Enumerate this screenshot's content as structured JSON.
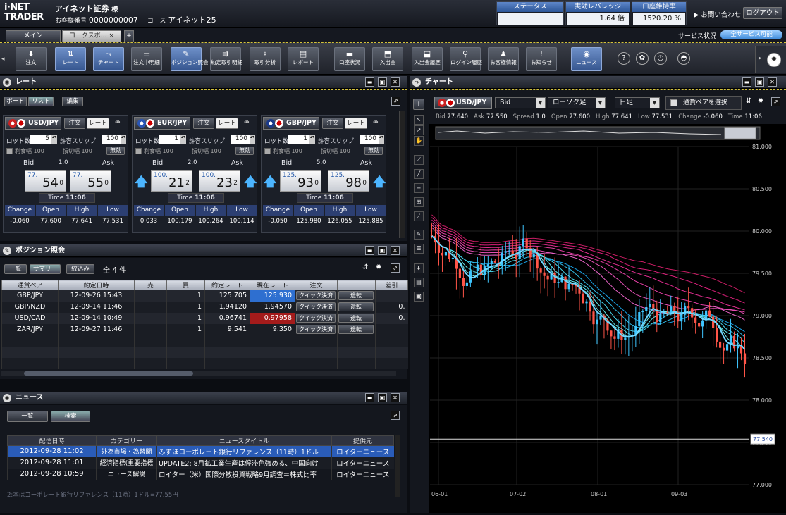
{
  "header": {
    "logo_line1": "i·NET",
    "logo_line2": "TRADER",
    "company": "アイネット証券",
    "honorific": "様",
    "account_label": "お客様番号",
    "account_no": "0000000007",
    "course_label": "コース",
    "course": "アイネット25",
    "status_label": "ステータス",
    "status_value": "",
    "leverage_label": "実効レバレッジ",
    "leverage_value": "1.64 倍",
    "margin_label": "口座維持率",
    "margin_value": "1520.20 %",
    "contact": "▶ お問い合わせ",
    "logout": "ログアウト"
  },
  "tabbar": {
    "tab_main": "メイン",
    "tab_rakuspo": "ロークスボ…",
    "tab_close": "×",
    "tab_add": "+",
    "service_status": "サービス状況",
    "all_service": "全サービス可能"
  },
  "toolbar": [
    {
      "icon": "down-arrow-icon",
      "glyph": "⬇",
      "label": "注文",
      "active": false
    },
    {
      "icon": "rate-icon",
      "glyph": "⇅",
      "label": "レート",
      "active": true
    },
    {
      "icon": "chart-icon",
      "glyph": "⤳",
      "label": "チャート",
      "active": true
    },
    {
      "icon": "order-list-icon",
      "glyph": "☰",
      "label": "注文中明細",
      "active": false
    },
    {
      "icon": "position-icon",
      "glyph": "✎",
      "label": "ポジション照会",
      "active": true
    },
    {
      "icon": "history-icon",
      "glyph": "⇉",
      "label": "約定取引明細",
      "active": false
    },
    {
      "icon": "analysis-icon",
      "glyph": "⌖",
      "label": "取引分析",
      "active": false
    },
    {
      "icon": "report-icon",
      "glyph": "▤",
      "label": "レポート",
      "active": false
    },
    {
      "icon": "account-icon",
      "glyph": "▬",
      "label": "口座状況",
      "active": false
    },
    {
      "icon": "deposit-icon",
      "glyph": "⬒",
      "label": "入出金",
      "active": false
    },
    {
      "icon": "deposit-history-icon",
      "glyph": "⬓",
      "label": "入出金履歴",
      "active": false
    },
    {
      "icon": "login-history-icon",
      "glyph": "⚲",
      "label": "ログイン履歴",
      "active": false
    },
    {
      "icon": "customer-icon",
      "glyph": "♟",
      "label": "お客様情報",
      "active": false
    },
    {
      "icon": "notice-icon",
      "glyph": "!",
      "label": "お知らせ",
      "active": false
    },
    {
      "icon": "news-icon",
      "glyph": "◉",
      "label": "ニュース",
      "active": true
    }
  ],
  "rate_panel": {
    "title": "レート",
    "btn_board": "ボード",
    "btn_list": "リスト",
    "btn_edit": "編集",
    "cards": [
      {
        "pair": "USD/JPY",
        "order": "注文",
        "rate": "レート",
        "lot_label": "ロット数",
        "lot": "5",
        "slip_label": "許容スリップ",
        "slip": "100",
        "profit": "利食幅 100",
        "loss": "損切幅 100",
        "invalid": "無効",
        "bid_label": "Bid",
        "ask_label": "Ask",
        "spread": "1.0",
        "bid_small": "77.",
        "bid_big": "54",
        "bid_frac": "0",
        "ask_small": "77.",
        "ask_big": "55",
        "ask_frac": "0",
        "time_label": "Time",
        "time": "11:06",
        "change": "-0.060",
        "open": "77.600",
        "high": "77.641",
        "low": "77.531",
        "arrows": false
      },
      {
        "pair": "EUR/JPY",
        "order": "注文",
        "rate": "レート",
        "lot_label": "ロット数",
        "lot": "1",
        "slip_label": "許容スリップ",
        "slip": "100",
        "profit": "利食幅 100",
        "loss": "損切幅 100",
        "invalid": "無効",
        "bid_label": "Bid",
        "ask_label": "Ask",
        "spread": "2.0",
        "bid_small": "100.",
        "bid_big": "21",
        "bid_frac": "2",
        "ask_small": "100.",
        "ask_big": "23",
        "ask_frac": "2",
        "time_label": "Time",
        "time": "11:06",
        "change": "0.033",
        "open": "100.179",
        "high": "100.264",
        "low": "100.114",
        "arrows": true
      },
      {
        "pair": "GBP/JPY",
        "order": "注文",
        "rate": "レート",
        "lot_label": "ロット数",
        "lot": "1",
        "slip_label": "許容スリップ",
        "slip": "100",
        "profit": "利食幅 100",
        "loss": "損切幅 100",
        "invalid": "無効",
        "bid_label": "Bid",
        "ask_label": "Ask",
        "spread": "5.0",
        "bid_small": "125.",
        "bid_big": "93",
        "bid_frac": "0",
        "ask_small": "125.",
        "ask_big": "98",
        "ask_frac": "0",
        "time_label": "Time",
        "time": "11:06",
        "change": "-0.050",
        "open": "125.980",
        "high": "126.055",
        "low": "125.885",
        "arrows": true
      }
    ],
    "stat_headers": [
      "Change",
      "Open",
      "High",
      "Low"
    ]
  },
  "position_panel": {
    "title": "ポジション照会",
    "btn_list": "一覧",
    "btn_summary": "サマリー",
    "btn_filter": "絞込み",
    "count_prefix": "全",
    "count": "4",
    "count_suffix": "件",
    "headers": [
      "通貨ペア",
      "約定日時",
      "売",
      "買",
      "約定レート",
      "現在レート",
      "注文",
      "",
      "差引"
    ],
    "rows": [
      {
        "pair": "GBP/JPY",
        "date": "12-09-26 15:43",
        "sell": "",
        "buy": "1",
        "exec": "125.705",
        "current": "125.930",
        "quick": "クイック決済",
        "reverse": "途転",
        "diff": "",
        "hl": "blue"
      },
      {
        "pair": "GBP/NZD",
        "date": "12-09-14 11:46",
        "sell": "",
        "buy": "1",
        "exec": "1.94120",
        "current": "1.94570",
        "quick": "クイック決済",
        "reverse": "途転",
        "diff": "0.",
        "hl": ""
      },
      {
        "pair": "USD/CAD",
        "date": "12-09-14 10:49",
        "sell": "",
        "buy": "1",
        "exec": "0.96741",
        "current": "0.97958",
        "quick": "クイック決済",
        "reverse": "途転",
        "diff": "0.",
        "hl": "red"
      },
      {
        "pair": "ZAR/JPY",
        "date": "12-09-27 11:46",
        "sell": "",
        "buy": "1",
        "exec": "9.541",
        "current": "9.350",
        "quick": "クイック決済",
        "reverse": "途転",
        "diff": "",
        "hl": ""
      }
    ]
  },
  "news_panel": {
    "title": "ニュース",
    "btn_list": "一覧",
    "btn_search": "検索",
    "headers": [
      "配信日時",
      "カテゴリー",
      "ニュースタイトル",
      "提供元"
    ],
    "rows": [
      {
        "date": "2012-09-28 11:02",
        "cat": "外為市場・為替関",
        "title": "みずほコーポレート銀行リファレンス（11時）1ドル",
        "src": "ロイターニュース"
      },
      {
        "date": "2012-09-28 11:01",
        "cat": "経済指標(重要指標",
        "title": "UPDATE2: 8月鉱工業生産は停滞色強める、中国向け",
        "src": "ロイターニュース"
      },
      {
        "date": "2012-09-28 10:59",
        "cat": "ニュース解説",
        "title": "ロイター（米）国際分散投資戦略9月調査＝株式比率",
        "src": "ロイターニュース"
      }
    ],
    "preview": "2:本はコーポレート銀行リファレンス（11時）1ドル=77.55円"
  },
  "chart_panel": {
    "title": "チャート",
    "pair": "USD/JPY",
    "side": "Bid",
    "type": "ローソク足",
    "period": "日足",
    "select_pair": "通貨ペアを選択",
    "info": [
      {
        "k": "Bid",
        "v": "77.640"
      },
      {
        "k": "Ask",
        "v": "77.550"
      },
      {
        "k": "Spread",
        "v": "1.0"
      },
      {
        "k": "Open",
        "v": "77.600"
      },
      {
        "k": "High",
        "v": "77.641"
      },
      {
        "k": "Low",
        "v": "77.531"
      },
      {
        "k": "Change",
        "v": "-0.060"
      },
      {
        "k": "Time",
        "v": "11:06"
      }
    ],
    "current_price": "77.540"
  },
  "chart_data": {
    "type": "candlestick",
    "y_ticks": [
      "81.000",
      "80.500",
      "80.000",
      "79.500",
      "79.000",
      "78.500",
      "78.000",
      "77.500",
      "77.000"
    ],
    "ylim": [
      77.0,
      81.0
    ],
    "x_ticks": [
      "06-01",
      "07-02",
      "08-01",
      "09-03"
    ],
    "last_price": 77.54
  }
}
